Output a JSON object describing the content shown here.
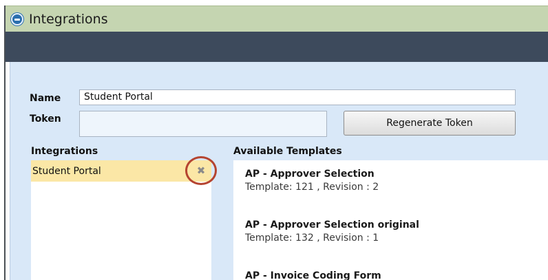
{
  "window": {
    "title": "Integrations",
    "icon": "app-logo-icon",
    "colors": {
      "titlebar": "#c5d5b1",
      "toolbar": "#3d4a5c",
      "content": "#d9e8f8",
      "selection": "#fbe7a6",
      "highlight": "#b54430"
    }
  },
  "form": {
    "name_label": "Name",
    "name_value": "Student Portal",
    "token_label": "Token",
    "token_value": "",
    "regenerate_label": "Regenerate Token"
  },
  "integrations": {
    "header": "Integrations",
    "items": [
      {
        "label": "Student Portal",
        "selected": true,
        "remove_icon": "close-icon",
        "remove_glyph": "✖"
      }
    ]
  },
  "templates": {
    "header": "Available Templates",
    "items": [
      {
        "name": "AP - Approver Selection",
        "meta": "Template: 121 , Revision : 2"
      },
      {
        "name": "AP - Approver Selection original",
        "meta": "Template: 132 , Revision : 1"
      },
      {
        "name": "AP - Invoice Coding Form",
        "meta": ""
      }
    ]
  }
}
